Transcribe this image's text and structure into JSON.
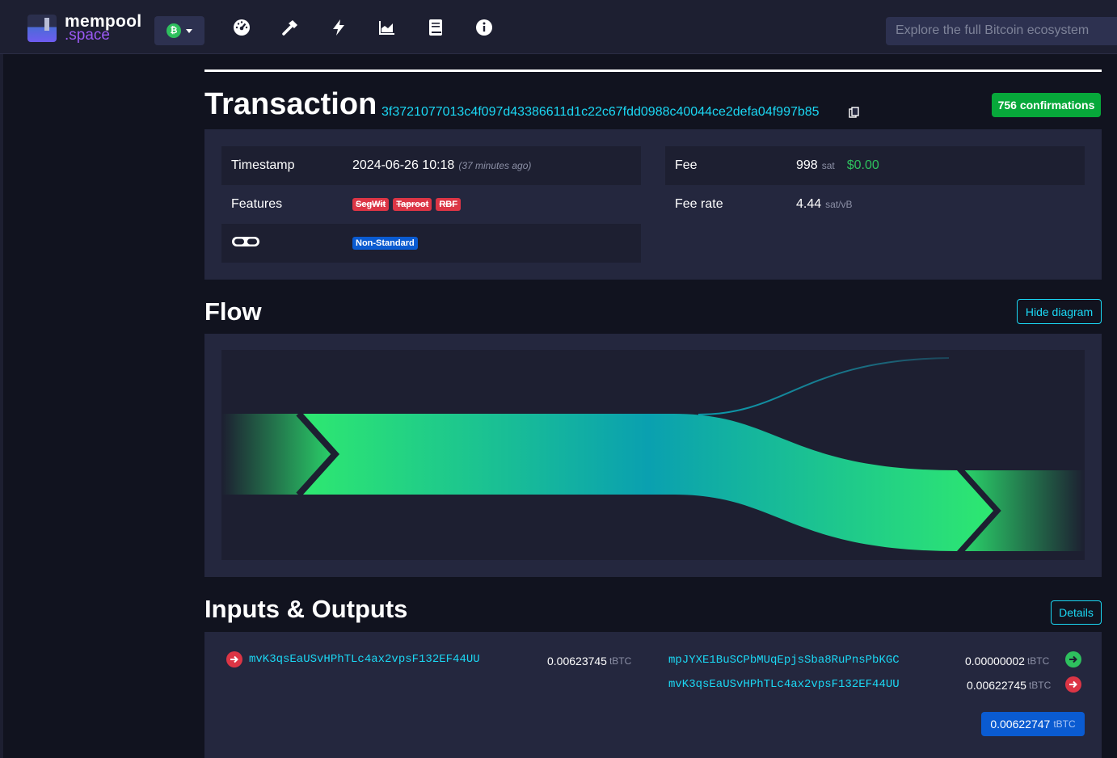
{
  "header": {
    "logo_line1": "mempool",
    "logo_line2": ".space",
    "network_badge": "₿",
    "search_placeholder": "Explore the full Bitcoin ecosystem",
    "nav_icons": [
      "dashboard-icon",
      "hammer-icon",
      "lightning-icon",
      "graphs-icon",
      "docs-icon",
      "info-icon"
    ]
  },
  "transaction": {
    "title": "Transaction",
    "txid": "3f3721077013c4f097d43386611d1c22c67fdd0988c40044ce2defa04f997b85",
    "confirmations": "756 confirmations",
    "details_left": [
      {
        "label": "Timestamp",
        "value": "2024-06-26 10:18",
        "note": "(37 minutes ago)"
      },
      {
        "label": "Features",
        "tags": [
          "SegWit",
          "Taproot",
          "RBF"
        ]
      },
      {
        "label": "",
        "icon": "goggles-icon",
        "tag": "Non-Standard"
      }
    ],
    "fee": {
      "label": "Fee",
      "value": "998",
      "unit": "sat",
      "usd": "$0.00"
    },
    "fee_rate": {
      "label": "Fee rate",
      "value": "4.44",
      "unit": "sat/vB"
    }
  },
  "flow": {
    "title": "Flow",
    "toggle_label": "Hide diagram"
  },
  "io": {
    "title": "Inputs & Outputs",
    "details_label": "Details",
    "inputs": [
      {
        "address": "mvK3qsEaUSvHPhTLc4ax2vpsF132EF44UU",
        "amount": "0.00623745",
        "unit": "tBTC"
      }
    ],
    "outputs": [
      {
        "address": "mpJYXE1BuSCPbMUqEpjsSba8RuPnsPbKGC",
        "amount": "0.00000002",
        "unit": "tBTC",
        "status": "unspent"
      },
      {
        "address": "mvK3qsEaUSvHPhTLc4ax2vpsF132EF44UU",
        "amount": "0.00622745",
        "unit": "tBTC",
        "status": "spent"
      }
    ],
    "total": "0.00622747",
    "total_unit": "tBTC"
  },
  "colors": {
    "accent": "#1bd8f4",
    "confirm_green": "#07a83a",
    "danger": "#dc3545",
    "primary_blue": "#0a5bd1"
  }
}
